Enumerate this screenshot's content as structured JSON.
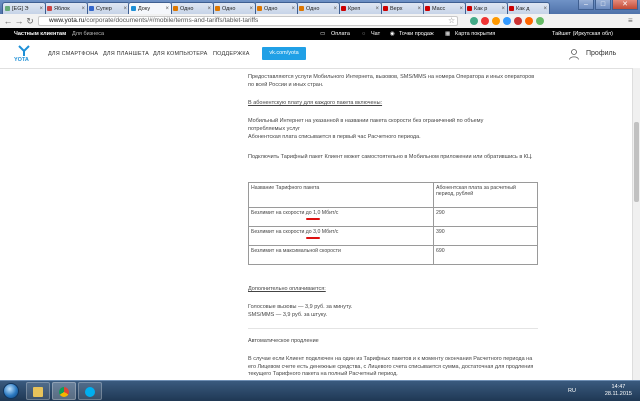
{
  "browser": {
    "tabs": [
      {
        "label": "[EG] Э",
        "icon_color": "#6a7"
      },
      {
        "label": "Яблок",
        "icon_color": "#c44"
      },
      {
        "label": "Супер",
        "icon_color": "#36c"
      },
      {
        "label": "Доку",
        "icon_color": "#1d8fd6",
        "active": true
      },
      {
        "label": "Одно",
        "icon_color": "#d70"
      },
      {
        "label": "Одно",
        "icon_color": "#d70"
      },
      {
        "label": "Одно",
        "icon_color": "#d70"
      },
      {
        "label": "Одно",
        "icon_color": "#d70"
      },
      {
        "label": "Креп",
        "icon_color": "#c00"
      },
      {
        "label": "Верх",
        "icon_color": "#c00"
      },
      {
        "label": "Масс",
        "icon_color": "#c00"
      },
      {
        "label": "Как р",
        "icon_color": "#c00"
      },
      {
        "label": "Как д",
        "icon_color": "#c00"
      }
    ],
    "tab_close": "×",
    "window_min": "–",
    "window_max": "□",
    "window_close": "✕",
    "nav_back": "←",
    "nav_forward": "→",
    "nav_reload": "↻",
    "url_host": "www.yota.ru",
    "url_path": "/corporate/documents/#/mobile/terms-and-tariffs/tablet-tariffs",
    "star_icon": "star-icon",
    "extension_colors": [
      "#4a8",
      "#e33",
      "#f90",
      "#39f",
      "#c33",
      "#f60",
      "#6b6"
    ]
  },
  "yota_top": {
    "private": "Частным клиентам",
    "business": "Для бизнеса",
    "payment": "Оплата",
    "chat": "Чат",
    "stores": "Точки продаж",
    "coverage": "Карта покрытия",
    "region": "Тайшет (Иркутская обл)"
  },
  "yota_nav": {
    "logo_text": "YOTA",
    "smartphone": "ДЛЯ СМАРТФОНА",
    "tablet": "ДЛЯ ПЛАНШЕТА",
    "computer": "ДЛЯ КОМПЬЮТЕРА",
    "support": "ПОДДЕРЖКА",
    "vk": "vk.com/yota",
    "profile": "Профиль",
    "accent": "#20a0e6"
  },
  "content": {
    "intro": "Предоставляются услуги Мобильного Интернета, вызовов, SMS/MMS на номера Оператора и иных операторов по всей России и иных стран.",
    "included_heading": "В абонентскую плату для каждого пакета включены:",
    "included_text": "Мобильный Интернет на указанной в названии пакета скорости без ограничений по объему потребляемых услуг",
    "billing_note": "Абонентская плата списывается в первый час Расчетного периода.",
    "connect_note": "Подключить Тарифный пакет Клиент может самостоятельно в Мобильном приложении или обратившись в КЦ.",
    "table": {
      "col1": "Название Тарифного пакета",
      "col2": "Абонентская плата за расчетный период, рублей",
      "rows": [
        {
          "name_pre": "Безлимит на скорости ",
          "name_hl": "до 1,0",
          "name_post": " Мбит/с",
          "price": "290"
        },
        {
          "name_pre": "Безлимит на скорости ",
          "name_hl": "до 3,0",
          "name_post": " Мбит/с",
          "price": "390"
        },
        {
          "name_pre": "Безлимит на максимальной скорости",
          "name_hl": "",
          "name_post": "",
          "price": "690"
        }
      ]
    },
    "extra_heading": "Дополнительно оплачивается:",
    "extra_calls": "Голосовые вызовы — 3,9 руб. за минуту.",
    "extra_sms": "SMS/MMS — 3,9 руб. за штуку.",
    "auto_heading": "Автоматическое продление",
    "auto_text": "В случае если Клиент подключен на один из Тарифных пакетов и к моменту окончания Расчетного периода на его Лицевом счете есть денежные средства, с Лицевого счета списывается сумма, достаточная для продления текущего Тарифного пакета на полный Расчетный период."
  },
  "taskbar": {
    "lang": "RU",
    "time": "14:47",
    "date": "28.11.2015"
  }
}
